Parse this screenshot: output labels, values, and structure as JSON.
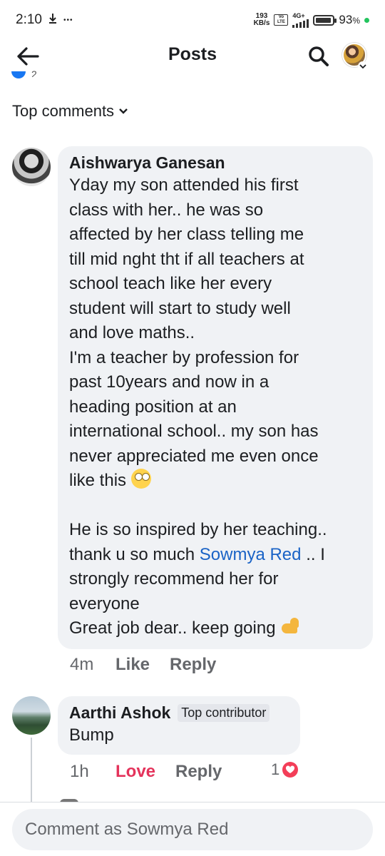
{
  "status_bar": {
    "time": "2:10",
    "download_icon": "download-arrow-icon",
    "more_dots": "•••",
    "net_speed_value": "193",
    "net_speed_unit": "KB/s",
    "volte": "Vo LTE",
    "net_type": "4G+",
    "battery_percent": "93",
    "battery_suffix": "%",
    "battery_level": 0.93,
    "charging_dot_color": "#23c45e"
  },
  "header": {
    "title": "Posts",
    "back_icon": "back-arrow-icon",
    "search_icon": "search-icon"
  },
  "post": {
    "reaction_count_fragment": "2"
  },
  "sort": {
    "label": "Top comments"
  },
  "comments": [
    {
      "author": "Aishwarya Ganesan",
      "lines": [
        "Yday my son attended his first",
        "class with her.. he was so",
        "affected by her class telling me",
        "till mid nght tht if all teachers at",
        "school teach like her every",
        "student will start to study well",
        "and love maths..",
        "I'm a teacher by profession for",
        "past 10years and now in a",
        "heading position at an",
        "international school.. my son has",
        "never appreciated me even once",
        "like this"
      ],
      "para2_line1": "He is so inspired by her teaching..",
      "para2_line2_pre": "thank u so much",
      "mention": "Sowmya Red",
      "para2_line2_post": ".. I",
      "para2_line3": "strongly recommend her for",
      "para2_line4": "everyone",
      "para2_line5": "Great job dear.. keep going",
      "time": "4m",
      "like_label": "Like",
      "reply_label": "Reply"
    },
    {
      "author": "Aarthi Ashok",
      "badge": "Top contributor",
      "text": "Bump",
      "time": "1h",
      "love_label": "Love",
      "reply_label": "Reply",
      "reaction_count": "1"
    }
  ],
  "composer": {
    "placeholder": "Comment as Sowmya Red"
  },
  "colors": {
    "link": "#1a63c6",
    "love": "#e4335b",
    "bubble": "#f0f2f5",
    "secondary_text": "#65676b"
  }
}
